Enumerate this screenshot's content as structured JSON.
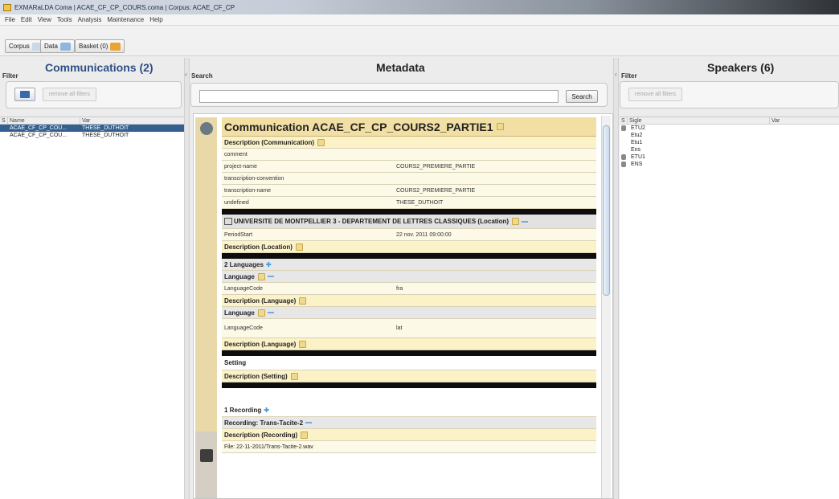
{
  "window": {
    "title": "EXMARaLDA Coma | ACAE_CF_CP_COURS.coma | Corpus: ACAE_CF_CP"
  },
  "menu": [
    "File",
    "Edit",
    "View",
    "Tools",
    "Analysis",
    "Maintenance",
    "Help"
  ],
  "toolbar": {
    "corpus_label": "Corpus",
    "data_label": "Data",
    "basket_label": "Basket (0)"
  },
  "left": {
    "heading": "Communications (2)",
    "filter_label": "Filter",
    "remove_filters": "remove all filters",
    "columns": [
      "S",
      "Name",
      "Var"
    ],
    "rows": [
      {
        "name": "ACAE_CF_CP_COU...",
        "var": "THESE_DUTHOIT"
      },
      {
        "name": "ACAE_CF_CP_COU...",
        "var": "THESE_DUTHOIT"
      }
    ]
  },
  "center": {
    "heading": "Metadata",
    "search_label": "Search",
    "search_value": "",
    "search_button": "Search",
    "communication_title": "Communication ACAE_CF_CP_COURS2_PARTIE1",
    "desc_comm": "Description (Communication)",
    "kv1": [
      {
        "k": "comment",
        "v": ""
      },
      {
        "k": "project-name",
        "v": "COURS2_PREMIERE_PARTIE"
      },
      {
        "k": "transcription-convention",
        "v": ""
      },
      {
        "k": "transcription-name",
        "v": "COURS2_PREMIERE_PARTIE"
      },
      {
        "k": "undefined",
        "v": "THESE_DUTHOIT"
      }
    ],
    "location_title": "UNIVERSITE DE MONTPELLIER 3 - DEPARTEMENT DE LETTRES CLASSIQUES (Location)",
    "period_start_key": "PeriodStart",
    "period_start_val": "22 nov. 2011 09:00:00",
    "desc_location": "Description (Location)",
    "languages_heading": "2 Languages",
    "language_label": "Language",
    "language_code_key": "LanguageCode",
    "lang1": "fra",
    "lang2": "lat",
    "desc_language": "Description (Language)",
    "setting_label": "Setting",
    "desc_setting": "Description (Setting)",
    "recording_heading": "1 Recording",
    "recording_title": "Recording: Trans-Tacite-2",
    "desc_recording": "Description (Recording)",
    "file_line": "File: 22-11-2011/Trans-Tacite-2.wav"
  },
  "right": {
    "heading": "Speakers (6)",
    "filter_label": "Filter",
    "remove_filters": "remove all filters",
    "columns": [
      "S",
      "Sigle",
      "Var"
    ],
    "speakers": [
      "ETU2",
      "Etu2",
      "Etu1",
      "Ens",
      "ETU1",
      "ENS"
    ]
  }
}
